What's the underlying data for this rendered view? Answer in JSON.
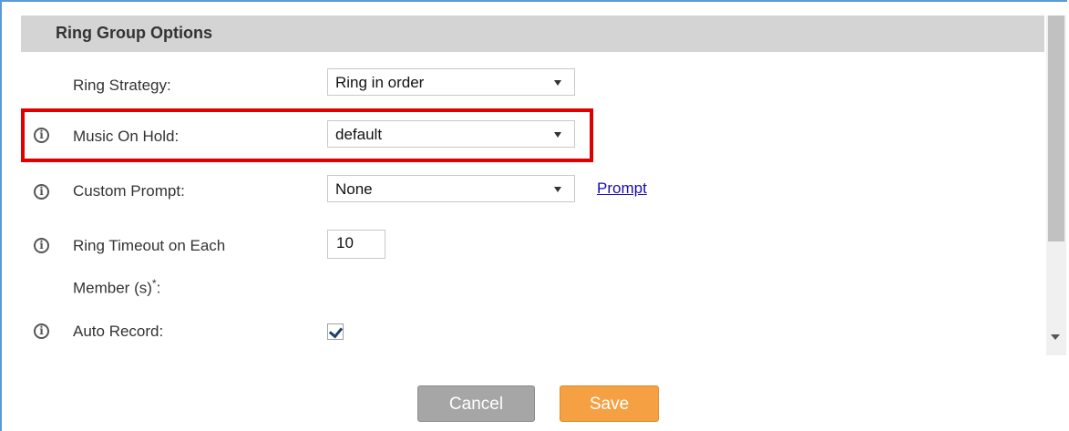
{
  "section": {
    "title": "Ring Group Options"
  },
  "fields": {
    "ring_strategy": {
      "label": "Ring Strategy:",
      "value": "Ring in order"
    },
    "music_on_hold": {
      "label": "Music On Hold:",
      "value": "default"
    },
    "custom_prompt": {
      "label": "Custom Prompt:",
      "value": "None",
      "link": "Prompt"
    },
    "ring_timeout": {
      "label_line1": "Ring Timeout on Each",
      "label_line2": "Member (s)",
      "required_mark": "*",
      "label_suffix": ":",
      "value": "10"
    },
    "auto_record": {
      "label": "Auto Record:",
      "checked": true
    }
  },
  "buttons": {
    "cancel": "Cancel",
    "save": "Save"
  },
  "colors": {
    "highlight": "#e00000",
    "save": "#f4a043",
    "cancel": "#a6a6a6",
    "link": "#1a0dab"
  },
  "icons": {
    "info": "info-circle-icon",
    "dropdown": "chevron-down-icon",
    "check": "checkmark-icon"
  }
}
